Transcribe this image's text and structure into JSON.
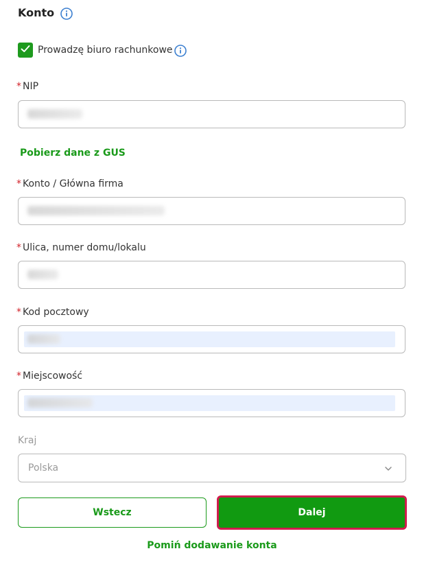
{
  "section": {
    "title": "Konto"
  },
  "checkbox": {
    "label": "Prowadzę biuro rachunkowe",
    "checked": true
  },
  "fields": {
    "nip": {
      "label": "NIP",
      "required": true
    },
    "gus_link": "Pobierz dane z GUS",
    "konto": {
      "label": "Konto / Główna firma",
      "required": true
    },
    "ulica": {
      "label": "Ulica, numer domu/lokalu",
      "required": true
    },
    "kod": {
      "label": "Kod pocztowy",
      "required": true
    },
    "miejscowosc": {
      "label": "Miejscowość",
      "required": true
    },
    "kraj": {
      "label": "Kraj",
      "value": "Polska"
    }
  },
  "buttons": {
    "back": "Wstecz",
    "next": "Dalej",
    "skip": "Pomiń dodawanie konta"
  },
  "colors": {
    "accent": "#1a9a1a",
    "required": "#d2232a",
    "focus_outline": "#d01c4e"
  },
  "icons": {
    "info": "info-icon",
    "check": "check-icon",
    "dropdown": "chevron-down-icon"
  }
}
